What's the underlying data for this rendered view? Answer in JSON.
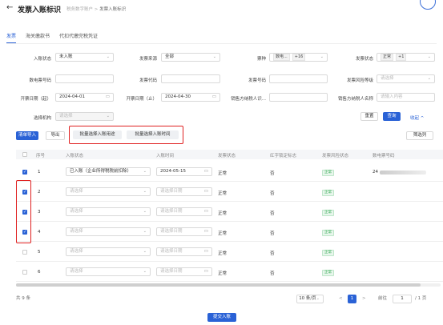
{
  "header": {
    "back_icon": "arrow-left-icon",
    "title": "发票入账标识",
    "breadcrumb_parent": "税务数字账户",
    "breadcrumb_sep": ">",
    "breadcrumb_current": "发票入账标识"
  },
  "tabs": [
    {
      "label": "发票",
      "active": true
    },
    {
      "label": "海关缴款书",
      "active": false
    },
    {
      "label": "代扣代缴完税凭证",
      "active": false
    }
  ],
  "filters": {
    "entry_status_label": "入账状态",
    "entry_status_value": "未入账",
    "invoice_source_label": "发票来源",
    "invoice_source_value": "全部",
    "invoice_type_label": "票种",
    "invoice_type_tag": "数电...",
    "invoice_type_more": "+16",
    "invoice_status_label": "发票状态",
    "invoice_status_tag": "正常",
    "invoice_status_more": "+1",
    "digital_no_label": "数电票号码",
    "invoice_code_label": "发票代码",
    "invoice_no_label": "发票号码",
    "risk_level_label": "发票风险等级",
    "risk_level_placeholder": "请选择",
    "date_start_label": "开票日期（起）",
    "date_start_value": "2024-04-01",
    "date_end_label": "开票日期（止）",
    "date_end_value": "2024-04-30",
    "seller_id_label": "销售方纳税人识...",
    "seller_name_label": "销售方纳税人名称",
    "seller_name_placeholder": "请输入内容",
    "org_label": "选择机构",
    "org_placeholder": "请选择"
  },
  "actions": {
    "reset": "重置",
    "query": "查询",
    "collapse": "收起 ^",
    "batch_import": "清单导入",
    "export": "导出",
    "batch_usage": "批量选择入账用途",
    "batch_time": "批量选择入账时间",
    "columns": "筛选列",
    "submit": "提交入账"
  },
  "table": {
    "headers": [
      "序号",
      "入账状态",
      "入账时间",
      "发票状态",
      "红字锁定标志",
      "发票风险状态",
      "数电票号码"
    ],
    "select_placeholder": "请选择",
    "date_placeholder": "请选择日期",
    "rows": [
      {
        "no": "1",
        "checked": true,
        "entry_status": "已入账（企业所得税税前扣除）",
        "entry_time": "2024-05-15",
        "invoice_status": "正常",
        "red_lock": "否",
        "risk": "正常",
        "digital_no": "24"
      },
      {
        "no": "2",
        "checked": true,
        "entry_status": "",
        "entry_time": "",
        "invoice_status": "正常",
        "red_lock": "否",
        "risk": "正常",
        "digital_no": ""
      },
      {
        "no": "3",
        "checked": true,
        "entry_status": "",
        "entry_time": "",
        "invoice_status": "正常",
        "red_lock": "否",
        "risk": "正常",
        "digital_no": ""
      },
      {
        "no": "4",
        "checked": true,
        "entry_status": "",
        "entry_time": "",
        "invoice_status": "正常",
        "red_lock": "否",
        "risk": "正常",
        "digital_no": ""
      },
      {
        "no": "5",
        "checked": false,
        "entry_status": "",
        "entry_time": "",
        "invoice_status": "正常",
        "red_lock": "否",
        "risk": "正常",
        "digital_no": ""
      },
      {
        "no": "6",
        "checked": false,
        "entry_status": "",
        "entry_time": "",
        "invoice_status": "正常",
        "red_lock": "否",
        "risk": "正常",
        "digital_no": ""
      }
    ]
  },
  "pagination": {
    "total": "共 9 条",
    "page_size": "10 条/页",
    "prev": "<",
    "current": "1",
    "next": ">",
    "goto_label": "前往",
    "goto_value": "1",
    "pages_total": "/ 1 页"
  },
  "colors": {
    "primary": "#2a62d6",
    "highlight": "#e02020",
    "success": "#2fa84f"
  }
}
